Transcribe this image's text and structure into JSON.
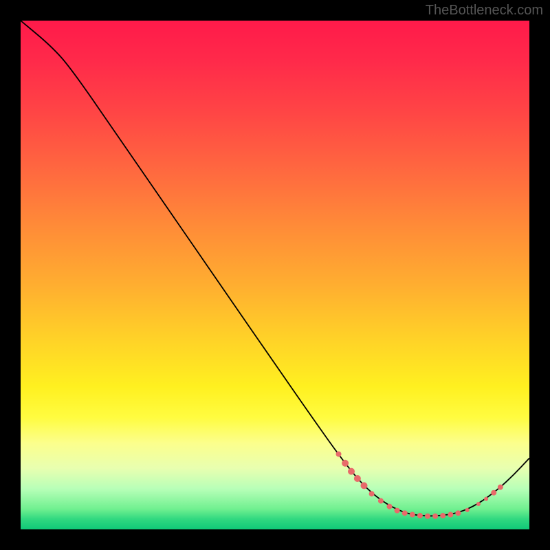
{
  "watermark": "TheBottleneck.com",
  "colors": {
    "background": "#000000",
    "dot": "#e86a6a",
    "curve": "#000000"
  },
  "chart_data": {
    "type": "line",
    "title": "",
    "xlabel": "",
    "ylabel": "",
    "xlim": [
      0,
      100
    ],
    "ylim": [
      0,
      100
    ],
    "curve_points": [
      {
        "x": 0,
        "y": 100
      },
      {
        "x": 6,
        "y": 95
      },
      {
        "x": 10,
        "y": 90.5
      },
      {
        "x": 20,
        "y": 76
      },
      {
        "x": 30,
        "y": 61.5
      },
      {
        "x": 40,
        "y": 47
      },
      {
        "x": 50,
        "y": 32.5
      },
      {
        "x": 58,
        "y": 21
      },
      {
        "x": 63,
        "y": 14
      },
      {
        "x": 67,
        "y": 9
      },
      {
        "x": 71,
        "y": 5.5
      },
      {
        "x": 75,
        "y": 3.4
      },
      {
        "x": 78,
        "y": 2.7
      },
      {
        "x": 82,
        "y": 2.6
      },
      {
        "x": 86,
        "y": 3.2
      },
      {
        "x": 90,
        "y": 5.0
      },
      {
        "x": 94,
        "y": 8.0
      },
      {
        "x": 97,
        "y": 10.8
      },
      {
        "x": 100,
        "y": 14
      }
    ],
    "dot_points": [
      {
        "x": 62.5,
        "y": 14.8,
        "r": 4
      },
      {
        "x": 63.8,
        "y": 13.0,
        "r": 5
      },
      {
        "x": 65.0,
        "y": 11.4,
        "r": 5
      },
      {
        "x": 66.2,
        "y": 10.0,
        "r": 5
      },
      {
        "x": 67.5,
        "y": 8.6,
        "r": 5
      },
      {
        "x": 69.0,
        "y": 7.0,
        "r": 4
      },
      {
        "x": 70.8,
        "y": 5.6,
        "r": 4
      },
      {
        "x": 72.5,
        "y": 4.5,
        "r": 4
      },
      {
        "x": 74.0,
        "y": 3.7,
        "r": 4
      },
      {
        "x": 75.5,
        "y": 3.2,
        "r": 4
      },
      {
        "x": 77.0,
        "y": 2.9,
        "r": 4
      },
      {
        "x": 78.5,
        "y": 2.7,
        "r": 4
      },
      {
        "x": 80.0,
        "y": 2.6,
        "r": 4
      },
      {
        "x": 81.5,
        "y": 2.6,
        "r": 4
      },
      {
        "x": 83.0,
        "y": 2.7,
        "r": 4
      },
      {
        "x": 84.5,
        "y": 2.9,
        "r": 4
      },
      {
        "x": 86.0,
        "y": 3.2,
        "r": 4
      },
      {
        "x": 87.8,
        "y": 3.8,
        "r": 3
      },
      {
        "x": 90.0,
        "y": 5.0,
        "r": 3
      },
      {
        "x": 91.5,
        "y": 6.0,
        "r": 3
      },
      {
        "x": 93.0,
        "y": 7.2,
        "r": 4
      },
      {
        "x": 94.3,
        "y": 8.3,
        "r": 4
      }
    ]
  }
}
